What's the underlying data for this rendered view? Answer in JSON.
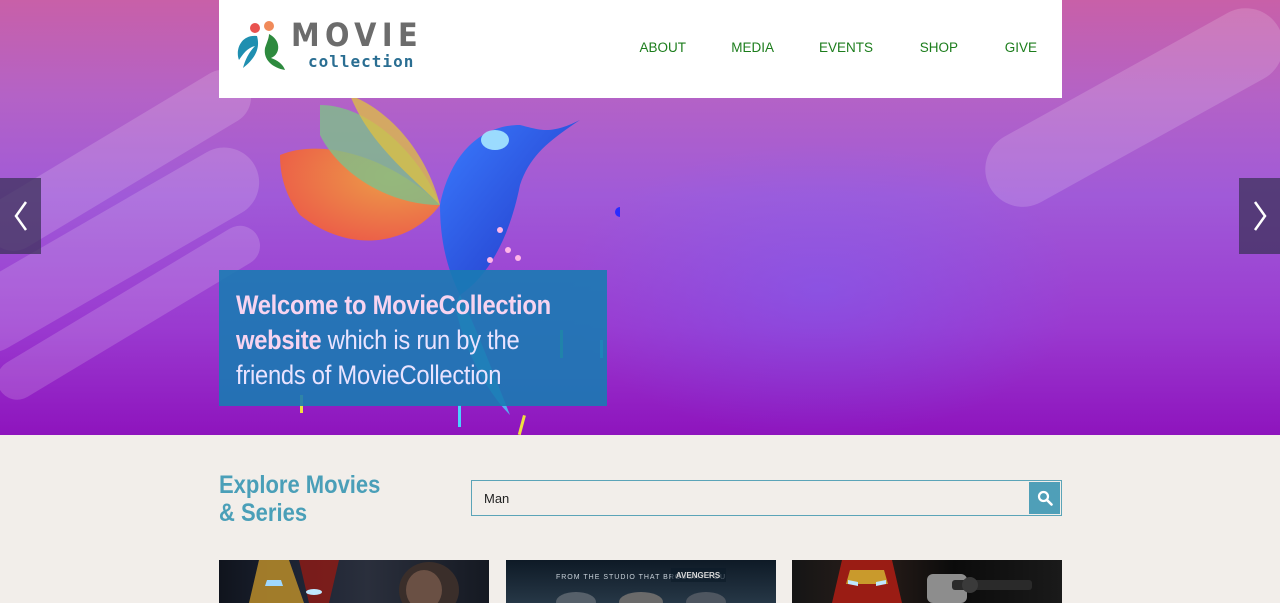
{
  "brand": {
    "title": "MOVIE",
    "subtitle": "collection"
  },
  "nav": {
    "items": [
      "ABOUT",
      "MEDIA",
      "EVENTS",
      "SHOP",
      "GIVE"
    ]
  },
  "hero": {
    "welcome_bold_1": "Welcome to MovieCollection",
    "welcome_bold_2": "website",
    "welcome_rest_1": " which is run by the",
    "welcome_rest_2": "friends of MovieCollection"
  },
  "explore": {
    "title_line1": "Explore Movies",
    "title_line2": "& Series",
    "search_value": "Man"
  },
  "posters": {
    "p2_tagline": "FROM THE STUDIO THAT BROUGHT YOU"
  },
  "icons": {
    "prev": "chevron-left-icon",
    "next": "chevron-right-icon",
    "search": "search-icon"
  },
  "colors": {
    "nav": "#1c7d1c",
    "accent": "#4f9fb8",
    "welcome_bg": "#1a7ab2"
  }
}
